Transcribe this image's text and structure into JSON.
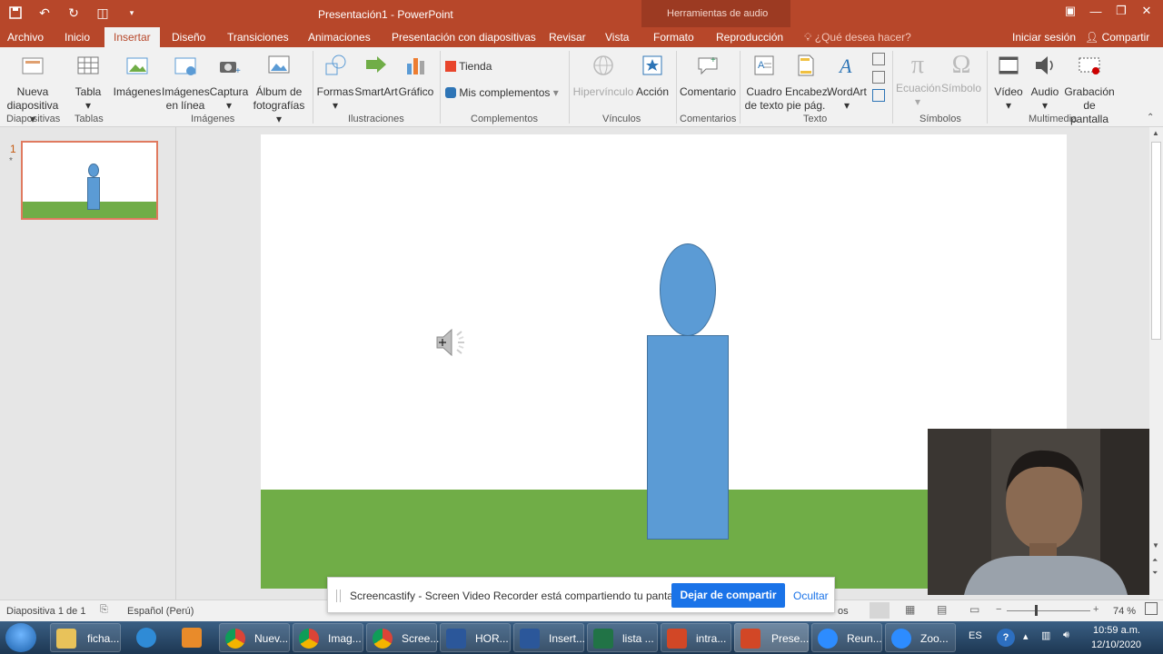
{
  "window": {
    "title": "Presentación1 - PowerPoint",
    "context_tab_header": "Herramientas de audio"
  },
  "tabs": [
    "Archivo",
    "Inicio",
    "Insertar",
    "Diseño",
    "Transiciones",
    "Animaciones",
    "Presentación con diapositivas",
    "Revisar",
    "Vista",
    "Formato",
    "Reproducción"
  ],
  "active_tab": "Insertar",
  "tell_me": "¿Qué desea hacer?",
  "signin": "Iniciar sesión",
  "share": "Compartir",
  "ribbon": {
    "new_slide": [
      "Nueva",
      "diapositiva"
    ],
    "table": "Tabla",
    "images": "Imágenes",
    "online_images": [
      "Imágenes",
      "en línea"
    ],
    "screenshot": "Captura",
    "photo_album": [
      "Álbum de",
      "fotografías"
    ],
    "shapes": "Formas",
    "smartart": "SmartArt",
    "chart": "Gráfico",
    "store": "Tienda",
    "my_addins": "Mis complementos",
    "hyperlink": "Hipervínculo",
    "action": "Acción",
    "comment": "Comentario",
    "textbox": [
      "Cuadro",
      "de texto"
    ],
    "header_footer": [
      "Encabez.",
      "pie pág."
    ],
    "wordart": "WordArt",
    "equation": "Ecuación",
    "symbol": "Símbolo",
    "video": "Vídeo",
    "audio": "Audio",
    "screen_recording": [
      "Grabación",
      "de pantalla"
    ],
    "groups": {
      "slides": "Diapositivas",
      "tables": "Tablas",
      "images": "Imágenes",
      "illustrations": "Ilustraciones",
      "addins": "Complementos",
      "links": "Vínculos",
      "comments": "Comentarios",
      "text": "Texto",
      "symbols": "Símbolos",
      "multimedia": "Multimedia"
    }
  },
  "thumbnail": {
    "number": "1",
    "star": "*"
  },
  "statusbar": {
    "slide_info": "Diapositiva 1 de 1",
    "language": "Español (Perú)",
    "notes_partial": "os",
    "zoom": "74 %"
  },
  "screencastify": {
    "message": "Screencastify - Screen Video Recorder está compartiendo tu pantalla.",
    "stop_button": "Dejar de compartir",
    "hide_link": "Ocultar"
  },
  "taskbar": {
    "items": [
      "ficha...",
      "Nuev...",
      "Imag...",
      "Scree...",
      "HOR...",
      "Insert...",
      "lista ...",
      "intra...",
      "Prese...",
      "Reun...",
      "Zoo..."
    ],
    "lang": "ES",
    "time": "10:59 a.m.",
    "date": "12/10/2020"
  },
  "colors": {
    "ppt_accent": "#b7472a",
    "shape_blue": "#5b9bd5",
    "grass_green": "#70ad47",
    "cast_blue": "#1a73e8"
  }
}
